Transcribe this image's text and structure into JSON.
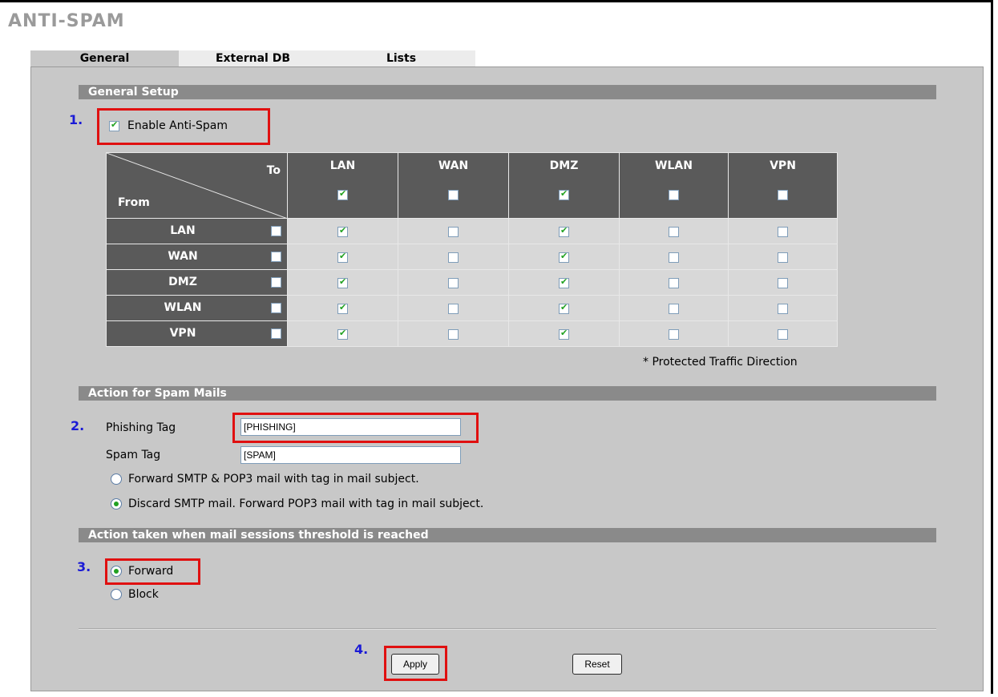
{
  "page": {
    "title": "ANTI-SPAM"
  },
  "tabs": [
    "General",
    "External DB",
    "Lists"
  ],
  "general_setup": {
    "header": "General Setup",
    "step": "1.",
    "enable_label": "Enable Anti-Spam",
    "enable_checked": true
  },
  "matrix": {
    "to_label": "To",
    "from_label": "From",
    "columns": [
      {
        "name": "LAN",
        "checked": true
      },
      {
        "name": "WAN",
        "checked": false
      },
      {
        "name": "DMZ",
        "checked": true
      },
      {
        "name": "WLAN",
        "checked": false
      },
      {
        "name": "VPN",
        "checked": false
      }
    ],
    "rows": [
      {
        "name": "LAN",
        "checked": false,
        "cells": [
          true,
          false,
          true,
          false,
          false
        ]
      },
      {
        "name": "WAN",
        "checked": false,
        "cells": [
          true,
          false,
          true,
          false,
          false
        ]
      },
      {
        "name": "DMZ",
        "checked": false,
        "cells": [
          true,
          false,
          true,
          false,
          false
        ]
      },
      {
        "name": "WLAN",
        "checked": false,
        "cells": [
          true,
          false,
          true,
          false,
          false
        ]
      },
      {
        "name": "VPN",
        "checked": false,
        "cells": [
          true,
          false,
          true,
          false,
          false
        ]
      }
    ],
    "footnote": "* Protected Traffic Direction"
  },
  "spam_action": {
    "header": "Action for Spam Mails",
    "step": "2.",
    "phishing_label": "Phishing Tag",
    "phishing_value": "[PHISHING]",
    "spam_label": "Spam Tag",
    "spam_value": "[SPAM]",
    "option_forward": "Forward SMTP & POP3 mail with tag in mail subject.",
    "option_discard": "Discard SMTP mail. Forward POP3 mail with tag in mail subject.",
    "selected": "discard"
  },
  "threshold_action": {
    "header": "Action taken when mail sessions threshold is reached",
    "step": "3.",
    "option_forward": "Forward",
    "option_block": "Block",
    "selected": "forward"
  },
  "buttons": {
    "step": "4.",
    "apply": "Apply",
    "reset": "Reset"
  }
}
